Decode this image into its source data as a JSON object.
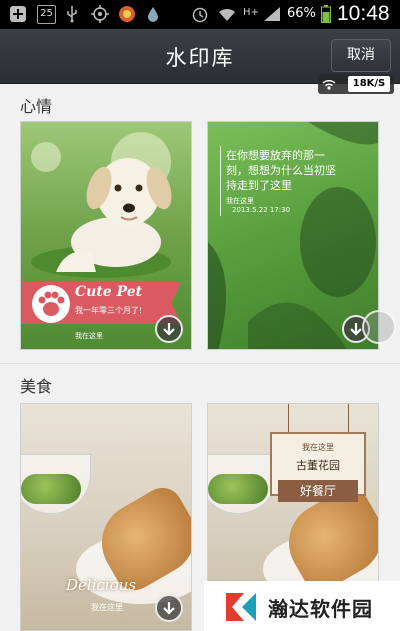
{
  "status_bar": {
    "date_badge": "25",
    "battery_percent": "66%",
    "time": "10:48",
    "network_type": "H+",
    "icons": [
      "plus-icon",
      "calendar-icon",
      "usb-icon",
      "gps-icon",
      "app-notification-icon",
      "drop-icon",
      "alarm-icon",
      "wifi-icon",
      "signal-icon",
      "battery-icon"
    ]
  },
  "header": {
    "title": "水印库",
    "cancel_label": "取消"
  },
  "network_badge": {
    "speed": "18K/S"
  },
  "sections": [
    {
      "title": "心情",
      "cards": [
        {
          "name": "cute-pet",
          "title": "Cute Pet",
          "subtitle": "我一年零三个月了!",
          "location": "我在这里"
        },
        {
          "name": "grass-quote",
          "quote": "在你想要放弃的那一刻，想想为什么当初坚持走到了这里",
          "location": "我在这里",
          "date": "2013.5.22 17:30"
        }
      ]
    },
    {
      "title": "美食",
      "cards": [
        {
          "name": "delicious",
          "title": "Delicious",
          "location": "我在这里"
        },
        {
          "name": "good-restaurant",
          "sign_line1": "我在这里",
          "sign_line2": "古董花园",
          "sign_plate": "好餐厅"
        }
      ]
    }
  ],
  "watermark": {
    "text": "瀚达软件园"
  },
  "colors": {
    "titlebar": "#2f3237",
    "ribbon": "#d95a60",
    "logo_red": "#e23c2f",
    "logo_teal": "#1d9fb8"
  }
}
